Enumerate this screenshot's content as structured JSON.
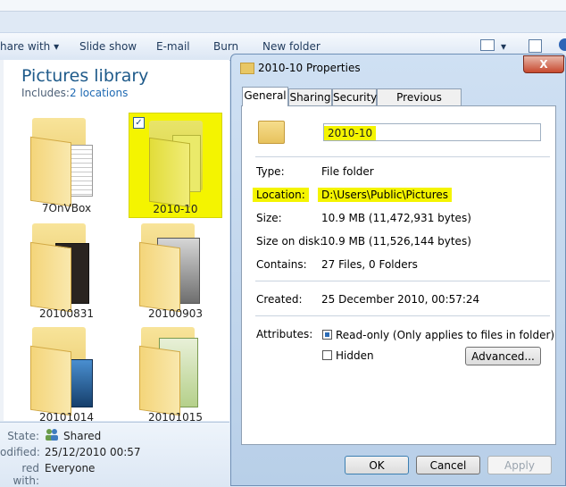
{
  "toolbar": {
    "items": [
      "hare with",
      "Slide show",
      "E-mail",
      "Burn",
      "New folder"
    ]
  },
  "library": {
    "title": "Pictures library",
    "includes_label": "Includes:",
    "locations_link": "2 locations",
    "tiles": [
      "7OnVBox",
      "2010-10",
      "20100831",
      "20100903",
      "20101014",
      "20101015"
    ],
    "selected_tile": "2010-10"
  },
  "details": {
    "state_label": "State:",
    "state_value": "Shared",
    "modified_label": "odified:",
    "modified_value": "25/12/2010 00:57",
    "shared_label": "red with:",
    "shared_value": "Everyone"
  },
  "dialog": {
    "title": "2010-10 Properties",
    "close_glyph": "X",
    "tabs": [
      "General",
      "Sharing",
      "Security",
      "Previous Versions"
    ],
    "active_tab": "General",
    "folder_name": "2010-10",
    "rows": {
      "type_label": "Type:",
      "type_value": "File folder",
      "location_label": "Location:",
      "location_value": "D:\\Users\\Public\\Pictures",
      "size_label": "Size:",
      "size_value": "10.9 MB (11,472,931 bytes)",
      "size_on_disk_label": "Size on disk:",
      "size_on_disk_value": "10.9 MB (11,526,144 bytes)",
      "contains_label": "Contains:",
      "contains_value": "27 Files, 0 Folders",
      "created_label": "Created:",
      "created_value": "25 December 2010, 00:57:24",
      "attributes_label": "Attributes:"
    },
    "attributes": {
      "readonly_label": "Read-only (Only applies to files in folder)",
      "readonly_state": "indeterminate",
      "hidden_label": "Hidden",
      "hidden_state": "unchecked",
      "advanced_button": "Advanced..."
    },
    "buttons": {
      "ok": "OK",
      "cancel": "Cancel",
      "apply": "Apply"
    },
    "colors": {
      "highlight": "#f4f400",
      "title_bar": "#c9dcf1",
      "close_button": "#c7492e"
    }
  }
}
